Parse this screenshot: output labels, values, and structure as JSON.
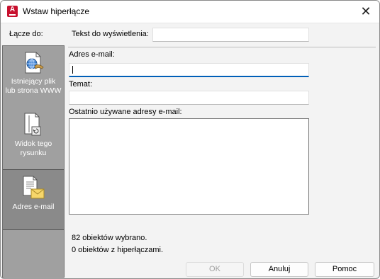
{
  "window": {
    "title": "Wstaw hiperłącze",
    "app_icon": "A"
  },
  "sidebar": {
    "label": "Łącze do:",
    "items": [
      {
        "label_line1": "Istniejący plik",
        "label_line2": "lub strona WWW",
        "icon": "globe-file-icon"
      },
      {
        "label_line1": "Widok tego",
        "label_line2": "rysunku",
        "icon": "drawing-view-icon"
      },
      {
        "label_line1": "Adres e-mail",
        "label_line2": "",
        "icon": "email-document-icon",
        "selected": true
      }
    ]
  },
  "form": {
    "display_text_label": "Tekst do wyświetlenia:",
    "display_text_value": "",
    "email_label": "Adres e-mail:",
    "email_value": "",
    "subject_label": "Temat:",
    "subject_value": "",
    "recent_label": "Ostatnio używane adresy e-mail:",
    "recent_items": []
  },
  "status": {
    "line1": "82 obiektów wybrano.",
    "line2": "0 obiektów z hiperłączami."
  },
  "buttons": {
    "ok": "OK",
    "cancel": "Anuluj",
    "help": "Pomoc"
  }
}
